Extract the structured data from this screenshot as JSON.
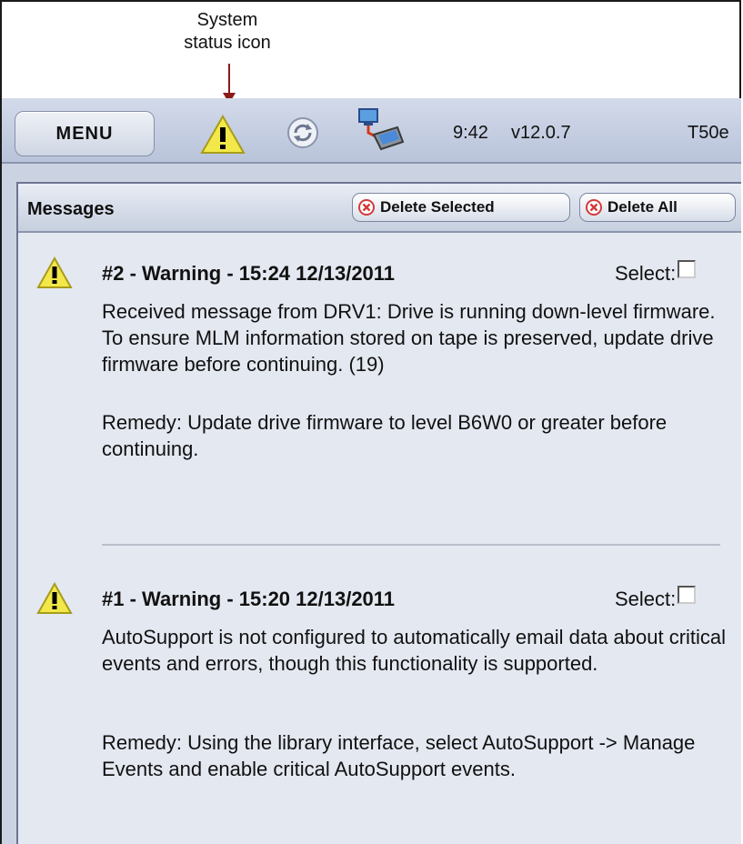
{
  "callout": {
    "line1": "System",
    "line2": "status icon"
  },
  "topbar": {
    "menu_label": "MENU",
    "time": "9:42",
    "version": "v12.0.7",
    "tag": "T50e",
    "icons": [
      "warning-icon",
      "sync-icon",
      "network-icon"
    ]
  },
  "messages": {
    "title": "Messages",
    "delete_selected": "Delete Selected",
    "delete_all": "Delete All",
    "items": [
      {
        "number": "#2 - ",
        "severity": "Warning",
        "timestamp": " - 15:24 12/13/2011",
        "select_label": "Select:",
        "body": "Received message from DRV1: Drive is running down-level firmware. To ensure MLM information stored on tape is preserved, update drive firmware before continuing. (19)",
        "remedy": "Remedy: Update drive firmware to level B6W0 or greater before continuing."
      },
      {
        "number": "#1 - ",
        "severity": "Warning",
        "timestamp": " - 15:20 12/13/2011",
        "select_label": "Select:",
        "body": "AutoSupport is not configured to automatically email data about critical events and errors, though this functionality is supported.",
        "remedy": "Remedy: Using the library interface, select AutoSupport -> Manage Events and enable critical AutoSupport events."
      }
    ]
  },
  "colors": {
    "accent": "#8b1a1a",
    "bar": "#c4cde0",
    "warning_yellow": "#f0e442"
  }
}
